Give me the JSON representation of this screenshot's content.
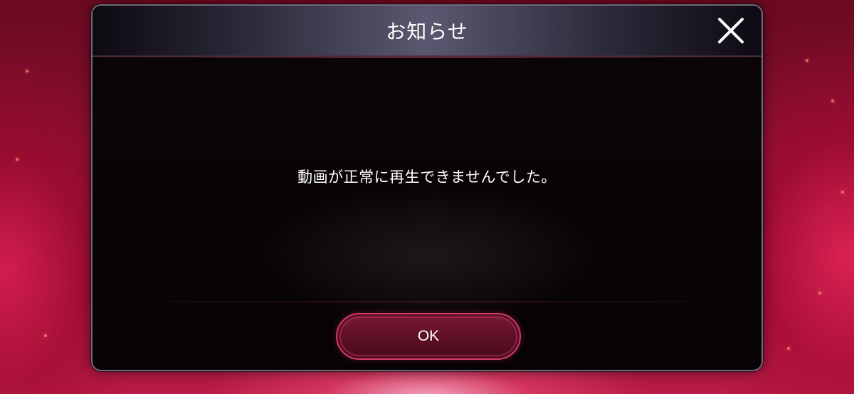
{
  "dialog": {
    "title": "お知らせ",
    "message": "動画が正常に再生できませんでした。",
    "close_icon": "close-icon",
    "ok_label": "OK"
  },
  "colors": {
    "accent": "#d2386a",
    "background": "#a3143d",
    "panel": "#070305",
    "text": "#ffffff"
  }
}
